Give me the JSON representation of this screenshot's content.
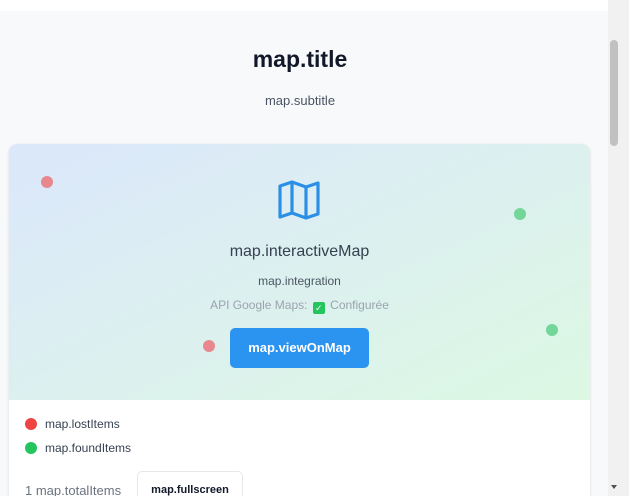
{
  "header": {
    "title": "map.title",
    "subtitle": "map.subtitle"
  },
  "map": {
    "icon": "map-icon",
    "interactive_label": "map.interactiveMap",
    "integration_label": "map.integration",
    "api_label": "API Google Maps:",
    "api_status_icon": "check-icon",
    "api_status": "Configurée",
    "view_button": "map.viewOnMap",
    "colors": {
      "lost_marker": "#e8878d",
      "found_marker": "#74d79a",
      "button": "#2b93f0"
    }
  },
  "legend": {
    "lost": "map.lostItems",
    "found": "map.foundItems",
    "lost_color": "#ef4444",
    "found_color": "#22c55e"
  },
  "footer": {
    "total": "1 map.totalItems",
    "fullscreen_button": "map.fullscreen"
  }
}
